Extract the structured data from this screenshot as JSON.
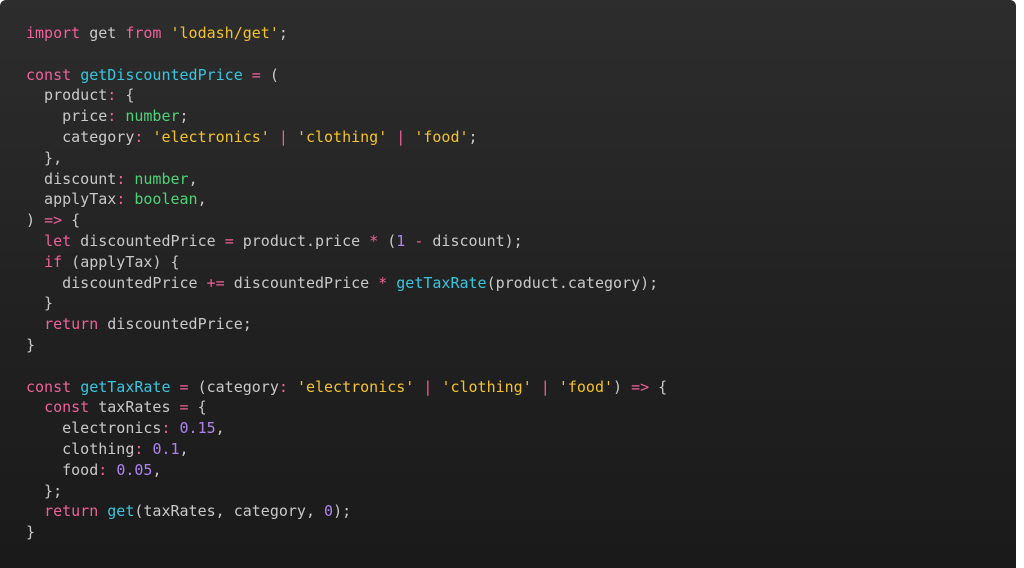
{
  "code": {
    "lines": [
      [
        [
          "kw",
          "import"
        ],
        [
          "id",
          " get "
        ],
        [
          "kw",
          "from"
        ],
        [
          "id",
          " "
        ],
        [
          "str",
          "'lodash/get'"
        ],
        [
          "punc",
          ";"
        ]
      ],
      [],
      [
        [
          "kw",
          "const"
        ],
        [
          "id",
          " "
        ],
        [
          "fn",
          "getDiscountedPrice"
        ],
        [
          "id",
          " "
        ],
        [
          "op",
          "="
        ],
        [
          "punc",
          " ("
        ]
      ],
      [
        [
          "id",
          "  product"
        ],
        [
          "op",
          ":"
        ],
        [
          "punc",
          " {"
        ]
      ],
      [
        [
          "id",
          "    price"
        ],
        [
          "op",
          ":"
        ],
        [
          "id",
          " "
        ],
        [
          "type",
          "number"
        ],
        [
          "punc",
          ";"
        ]
      ],
      [
        [
          "id",
          "    category"
        ],
        [
          "op",
          ":"
        ],
        [
          "id",
          " "
        ],
        [
          "str",
          "'electronics'"
        ],
        [
          "id",
          " "
        ],
        [
          "op",
          "|"
        ],
        [
          "id",
          " "
        ],
        [
          "str",
          "'clothing'"
        ],
        [
          "id",
          " "
        ],
        [
          "op",
          "|"
        ],
        [
          "id",
          " "
        ],
        [
          "str",
          "'food'"
        ],
        [
          "punc",
          ";"
        ]
      ],
      [
        [
          "punc",
          "  },"
        ]
      ],
      [
        [
          "id",
          "  discount"
        ],
        [
          "op",
          ":"
        ],
        [
          "id",
          " "
        ],
        [
          "type",
          "number"
        ],
        [
          "punc",
          ","
        ]
      ],
      [
        [
          "id",
          "  applyTax"
        ],
        [
          "op",
          ":"
        ],
        [
          "id",
          " "
        ],
        [
          "type",
          "boolean"
        ],
        [
          "punc",
          ","
        ]
      ],
      [
        [
          "punc",
          ")"
        ],
        [
          "id",
          " "
        ],
        [
          "op",
          "=>"
        ],
        [
          "punc",
          " {"
        ]
      ],
      [
        [
          "id",
          "  "
        ],
        [
          "kw",
          "let"
        ],
        [
          "id",
          " discountedPrice "
        ],
        [
          "op",
          "="
        ],
        [
          "id",
          " product.price "
        ],
        [
          "op",
          "*"
        ],
        [
          "punc",
          " ("
        ],
        [
          "num",
          "1"
        ],
        [
          "id",
          " "
        ],
        [
          "op",
          "-"
        ],
        [
          "id",
          " discount"
        ],
        [
          "punc",
          ");"
        ]
      ],
      [
        [
          "id",
          "  "
        ],
        [
          "kw",
          "if"
        ],
        [
          "punc",
          " ("
        ],
        [
          "id",
          "applyTax"
        ],
        [
          "punc",
          ") {"
        ]
      ],
      [
        [
          "id",
          "    discountedPrice "
        ],
        [
          "op",
          "+="
        ],
        [
          "id",
          " discountedPrice "
        ],
        [
          "op",
          "*"
        ],
        [
          "id",
          " "
        ],
        [
          "fn",
          "getTaxRate"
        ],
        [
          "punc",
          "("
        ],
        [
          "id",
          "product.category"
        ],
        [
          "punc",
          ");"
        ]
      ],
      [
        [
          "punc",
          "  }"
        ]
      ],
      [
        [
          "id",
          "  "
        ],
        [
          "kw",
          "return"
        ],
        [
          "id",
          " discountedPrice"
        ],
        [
          "punc",
          ";"
        ]
      ],
      [
        [
          "punc",
          "}"
        ]
      ],
      [],
      [
        [
          "kw",
          "const"
        ],
        [
          "id",
          " "
        ],
        [
          "fn",
          "getTaxRate"
        ],
        [
          "id",
          " "
        ],
        [
          "op",
          "="
        ],
        [
          "punc",
          " ("
        ],
        [
          "id",
          "category"
        ],
        [
          "op",
          ":"
        ],
        [
          "id",
          " "
        ],
        [
          "str",
          "'electronics'"
        ],
        [
          "id",
          " "
        ],
        [
          "op",
          "|"
        ],
        [
          "id",
          " "
        ],
        [
          "str",
          "'clothing'"
        ],
        [
          "id",
          " "
        ],
        [
          "op",
          "|"
        ],
        [
          "id",
          " "
        ],
        [
          "str",
          "'food'"
        ],
        [
          "punc",
          ")"
        ],
        [
          "id",
          " "
        ],
        [
          "op",
          "=>"
        ],
        [
          "punc",
          " {"
        ]
      ],
      [
        [
          "id",
          "  "
        ],
        [
          "kw",
          "const"
        ],
        [
          "id",
          " taxRates "
        ],
        [
          "op",
          "="
        ],
        [
          "punc",
          " {"
        ]
      ],
      [
        [
          "id",
          "    electronics"
        ],
        [
          "op",
          ":"
        ],
        [
          "id",
          " "
        ],
        [
          "num",
          "0.15"
        ],
        [
          "punc",
          ","
        ]
      ],
      [
        [
          "id",
          "    clothing"
        ],
        [
          "op",
          ":"
        ],
        [
          "id",
          " "
        ],
        [
          "num",
          "0.1"
        ],
        [
          "punc",
          ","
        ]
      ],
      [
        [
          "id",
          "    food"
        ],
        [
          "op",
          ":"
        ],
        [
          "id",
          " "
        ],
        [
          "num",
          "0.05"
        ],
        [
          "punc",
          ","
        ]
      ],
      [
        [
          "punc",
          "  };"
        ]
      ],
      [
        [
          "id",
          "  "
        ],
        [
          "kw",
          "return"
        ],
        [
          "id",
          " "
        ],
        [
          "fn",
          "get"
        ],
        [
          "punc",
          "("
        ],
        [
          "id",
          "taxRates, category, "
        ],
        [
          "num",
          "0"
        ],
        [
          "punc",
          ");"
        ]
      ],
      [
        [
          "punc",
          "}"
        ]
      ]
    ],
    "colors": {
      "background": "#262626",
      "keyword": "#f0609a",
      "function": "#36c6e0",
      "string": "#f4c32c",
      "type": "#4ed37a",
      "number": "#b183f0",
      "plain": "#c9c9c9"
    }
  }
}
